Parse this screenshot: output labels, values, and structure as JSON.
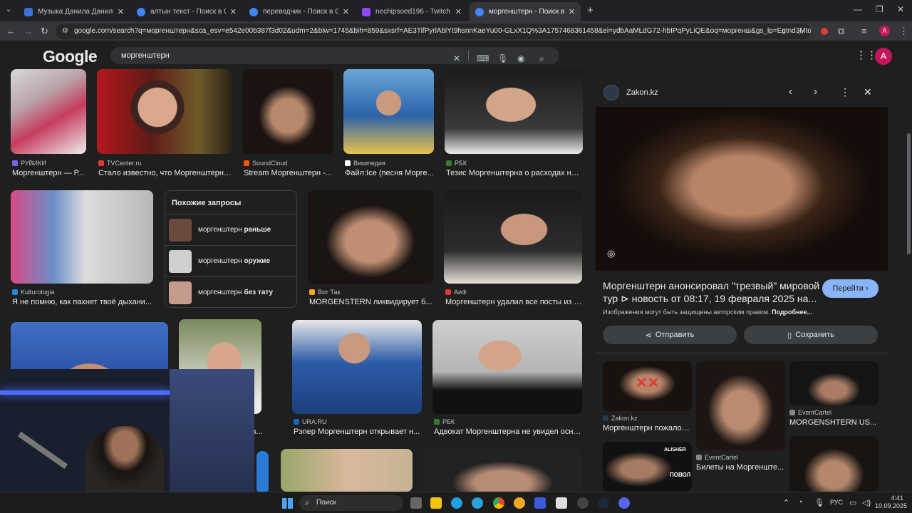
{
  "browser": {
    "tabs": [
      {
        "label": "Музыка Данила Данилова",
        "favicon_color": "#3f6fd8",
        "active": false
      },
      {
        "label": "алтын текст - Поиск в Google",
        "favicon_color": "#4285f4",
        "active": false
      },
      {
        "label": "переводчик - Поиск в Google",
        "favicon_color": "#4285f4",
        "active": false
      },
      {
        "label": "nechipsoed196 - Twitch",
        "favicon_color": "#9146ff",
        "active": false
      },
      {
        "label": "моргенштерн - Поиск в Goog",
        "favicon_color": "#4285f4",
        "active": true
      }
    ],
    "new_tab": "+",
    "url": "google.com/search?q=моргенштерн&sca_esv=e542e00b387f3d02&udm=2&biw=1745&bih=859&sxsrf=AE3TifPyrlAbiYt9hsnnKaeYu00-GLxX1Q%3A1757468361458&ei=ydbAaMLdG72-hbIPqPyLiQE&oq=моргенш&gs_lp=Egtnd3Mtd2l6..."
  },
  "google": {
    "logo": "Google",
    "query": "моргенштерн",
    "avatar_letter": "A"
  },
  "results": {
    "row1": [
      {
        "source": "РУВИКИ",
        "caption": "Моргенштерн — Р...",
        "src_color": "#7b61ff"
      },
      {
        "source": "TVCenter.ru",
        "caption": "Стало известно, что Моргенштерн*...",
        "src_color": "#e53935"
      },
      {
        "source": "SoundCloud",
        "caption": "Stream Моргенштерн -...",
        "src_color": "#ff5500"
      },
      {
        "source": "Википедия",
        "caption": "Файл:Ice (песня Морге...",
        "src_color": "#ffffff"
      },
      {
        "source": "РБК",
        "caption": "Тезис Моргенштерна о расходах на ...",
        "src_color": "#2e7d32"
      }
    ],
    "row2": [
      {
        "source": "Kulturologia",
        "caption": "Я не помню, как пахнет твоё дыхани...",
        "src_color": "#1e88e5"
      },
      {
        "source": "Вот Так",
        "caption": "MORGENSTERN ликвидирует б...",
        "src_color": "#f9a825"
      },
      {
        "source": "АиФ",
        "caption": "Моргенштерн удалил все посты из с...",
        "src_color": "#e53935"
      }
    ],
    "related": {
      "title": "Похожие запросы",
      "items": [
        {
          "base": "моргенштерн",
          "bold": "раньше"
        },
        {
          "base": "моргенштерн",
          "bold": "оружие"
        },
        {
          "base": "моргенштерн",
          "bold": "без тату"
        }
      ]
    },
    "row3": [
      {
        "source": "",
        "caption": "...л зв...",
        "src_color": "#888888"
      },
      {
        "source": "URA.RU",
        "caption": "Рэпер Моргенштерн открывает н...",
        "src_color": "#1565c0"
      },
      {
        "source": "РБК",
        "caption": "Адвокат Моргенштерна не увидел осно...",
        "src_color": "#2e7d32"
      }
    ]
  },
  "panel": {
    "source": "Zakon.kz",
    "title_line1": "Моргенштерн анонсировал \"трезвый\" мировой",
    "title_line2": "тур ⊳ новость от 08:17, 19 февраля 2025 на...",
    "visit_label": "Перейти",
    "copyright": "Изображения могут быть защищены авторским правом.",
    "more": "Подробнее...",
    "share_label": "Отправить",
    "save_label": "Сохранить",
    "similar": [
      {
        "source": "Zakon.kz",
        "caption": "Моргенштерн пожалов..."
      },
      {
        "source": "EventCartel",
        "caption": "MORGENSHTERN US..."
      },
      {
        "source": "EventCartel",
        "caption": "Билеты на Моргенште..."
      }
    ],
    "thumb_texts": [
      "ALISHER",
      "ПОВОЛ"
    ]
  },
  "taskbar": {
    "search_placeholder": "Поиск",
    "lang": "РУС",
    "time": "4:41",
    "date": "10.09.2025"
  }
}
